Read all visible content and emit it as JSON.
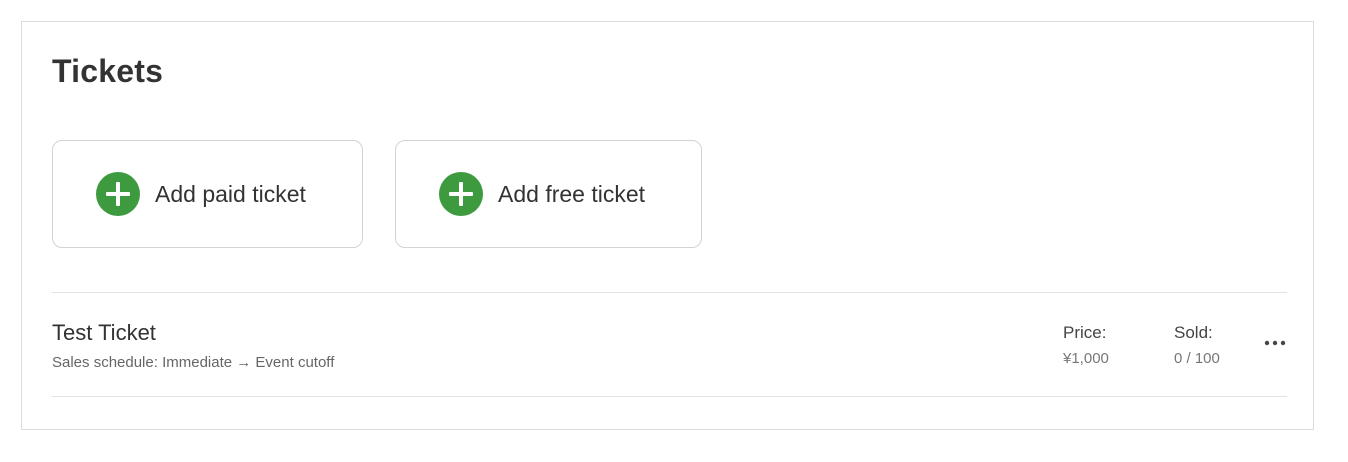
{
  "section": {
    "title": "Tickets"
  },
  "actions": {
    "add_paid_label": "Add paid ticket",
    "add_free_label": "Add free ticket",
    "icon": "plus-circle-icon",
    "accent_color": "#3d9a3f"
  },
  "tickets": [
    {
      "name": "Test Ticket",
      "schedule": "Sales schedule: Immediate → Event cutoff",
      "price_label": "Price:",
      "price_value": "¥1,000",
      "sold_label": "Sold:",
      "sold_value": "0 / 100",
      "menu_icon": "more-horizontal-icon"
    }
  ]
}
